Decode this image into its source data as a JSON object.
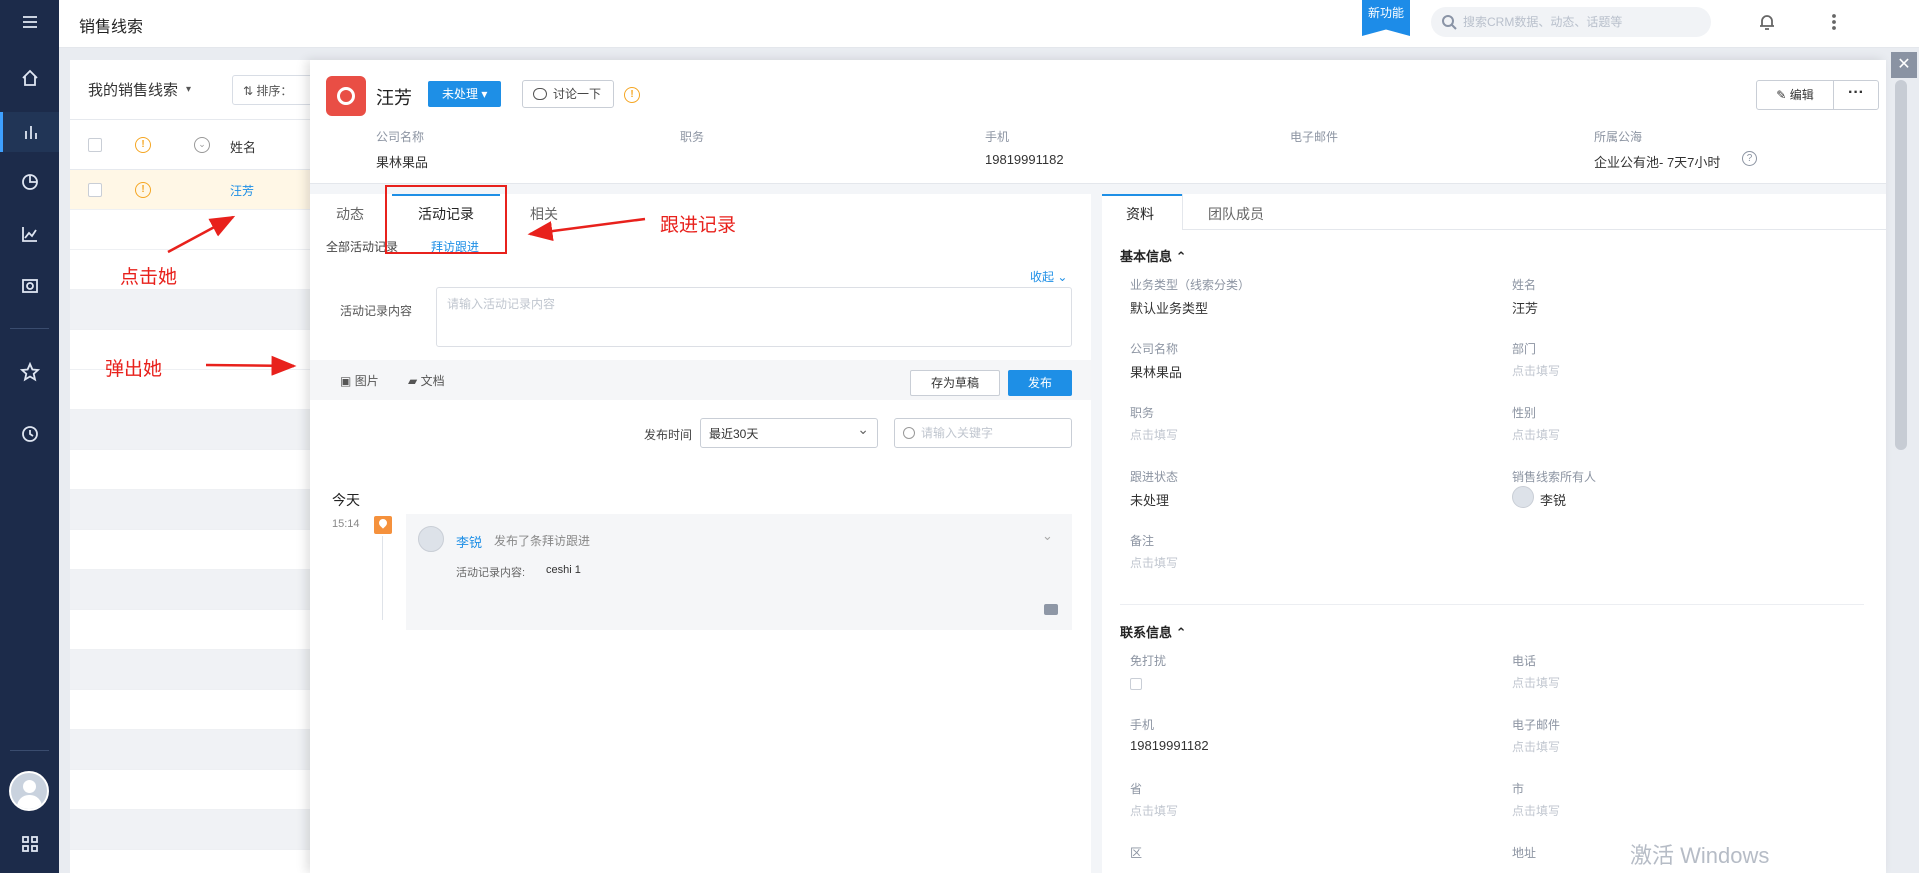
{
  "topbar": {
    "title": "销售线索",
    "new_feature": "新功能",
    "search_placeholder": "搜索CRM数据、动态、话题等"
  },
  "list": {
    "scope": "我的销售线索",
    "sort_label": "排序：",
    "column_name": "姓名",
    "rows": [
      {
        "name": "汪芳"
      }
    ]
  },
  "detail": {
    "name": "汪芳",
    "status": "未处理 ▾",
    "discuss": "讨论一下",
    "edit": "编辑",
    "more": "···",
    "header_fields": [
      {
        "label": "公司名称",
        "value": "果林果品"
      },
      {
        "label": "职务",
        "value": ""
      },
      {
        "label": "手机",
        "value": "19819991182"
      },
      {
        "label": "电子邮件",
        "value": ""
      },
      {
        "label": "所属公海",
        "value": "企业公有池- 7天7小时"
      }
    ],
    "tabs": [
      "动态",
      "活动记录",
      "相关"
    ],
    "subtabs": [
      "全部活动记录",
      "拜访跟进"
    ],
    "collapse": "收起",
    "form_label": "活动记录内容",
    "form_placeholder": "请输入活动记录内容",
    "tool_image": "图片",
    "tool_doc": "文档",
    "save_draft": "存为草稿",
    "publish": "发布",
    "filter_label": "发布时间",
    "filter_value": "最近30天",
    "keyword_placeholder": "请输入关键字",
    "today": "今天",
    "activity": {
      "time": "15:14",
      "user": "李锐",
      "desc": "发布了条拜访跟进",
      "content_label": "活动记录内容:",
      "content_value": "ceshi 1"
    }
  },
  "info": {
    "tabs": [
      "资料",
      "团队成员"
    ],
    "basic_title": "基本信息",
    "contact_title": "联系信息",
    "empty_hint": "点击填写",
    "basic_fields": [
      {
        "label": "业务类型（线索分类）",
        "value": "默认业务类型"
      },
      {
        "label": "姓名",
        "value": "汪芳"
      },
      {
        "label": "公司名称",
        "value": "果林果品"
      },
      {
        "label": "部门",
        "value": "点击填写"
      },
      {
        "label": "职务",
        "value": "点击填写"
      },
      {
        "label": "性别",
        "value": "点击填写"
      },
      {
        "label": "跟进状态",
        "value": "未处理"
      },
      {
        "label": "销售线索所有人",
        "value": "李锐"
      },
      {
        "label": "备注",
        "value": "点击填写"
      }
    ],
    "contact_fields": [
      {
        "label": "免打扰",
        "value": ""
      },
      {
        "label": "电话",
        "value": "点击填写"
      },
      {
        "label": "手机",
        "value": "19819991182"
      },
      {
        "label": "电子邮件",
        "value": "点击填写"
      },
      {
        "label": "省",
        "value": "点击填写"
      },
      {
        "label": "市",
        "value": "点击填写"
      },
      {
        "label": "区",
        "value": ""
      },
      {
        "label": "地址",
        "value": ""
      }
    ]
  },
  "annotations": {
    "click_her": "点击她",
    "popup_her": "弹出她",
    "follow_record": "跟进记录"
  },
  "watermark": "激活 Windows",
  "colors": {
    "accent": "#1e8fe6",
    "nav": "#1c2b4a",
    "annotation": "#e8211c",
    "warning": "#f5a623"
  }
}
